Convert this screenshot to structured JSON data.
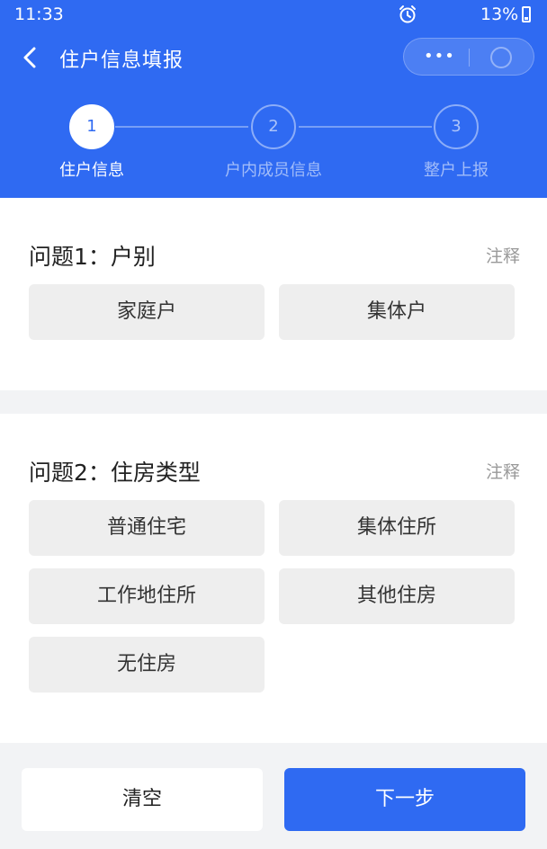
{
  "status_bar": {
    "time": "11:33",
    "battery": "13%"
  },
  "nav": {
    "title": "住户信息填报",
    "menu_dots": "•••"
  },
  "steps": [
    {
      "number": "1",
      "label": "住户信息"
    },
    {
      "number": "2",
      "label": "户内成员信息"
    },
    {
      "number": "3",
      "label": "整户上报"
    }
  ],
  "questions": [
    {
      "title": "问题1：户别",
      "note": "注释",
      "options": [
        "家庭户",
        "集体户"
      ]
    },
    {
      "title": "问题2：住房类型",
      "note": "注释",
      "options": [
        "普通住宅",
        "集体住所",
        "工作地住所",
        "其他住房",
        "无住房"
      ]
    }
  ],
  "footer": {
    "clear_label": "清空",
    "next_label": "下一步"
  },
  "colors": {
    "primary": "#2f6af2",
    "option_bg": "#eeeeee",
    "page_bg": "#f2f3f5"
  }
}
